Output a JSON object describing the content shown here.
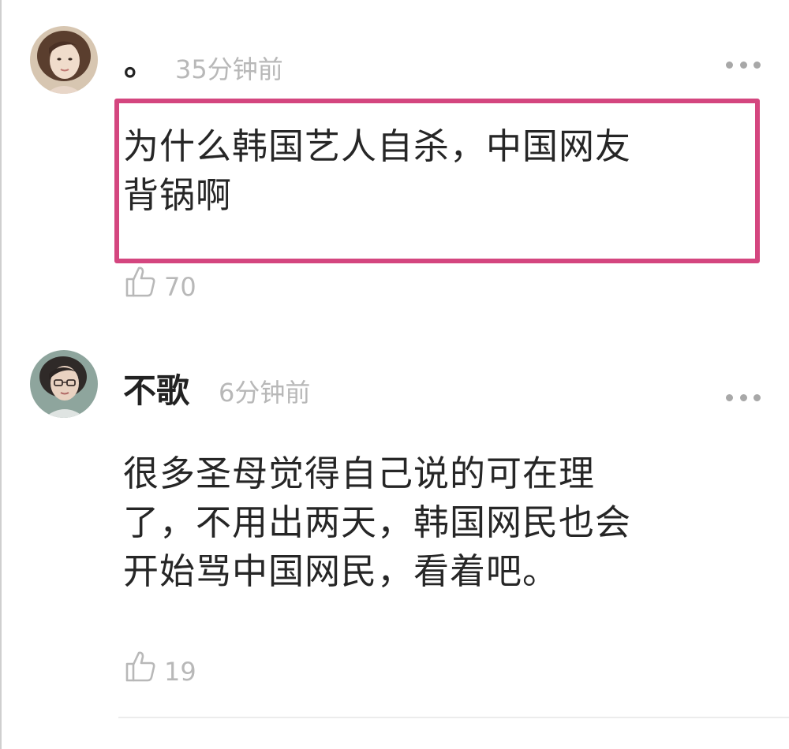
{
  "comments": [
    {
      "username": "。",
      "timestamp": "35分钟前",
      "content_lines": [
        "为什么韩国艺人自杀，中国网友",
        "背锅啊"
      ],
      "likes": "70",
      "highlighted": true,
      "avatar_icon": "user-avatar-icon"
    },
    {
      "username": "不歌",
      "timestamp": "6分钟前",
      "content_lines": [
        "很多圣母觉得自己说的可在理",
        "了，不用出两天，韩国网民也会",
        "开始骂中国网民，看着吧。"
      ],
      "likes": "19",
      "highlighted": false,
      "avatar_icon": "user-avatar-icon"
    }
  ],
  "icons": {
    "like": "thumbs-up-icon",
    "more": "more-options-icon"
  },
  "colors": {
    "highlight_border": "#d4467f",
    "text_primary": "#262626",
    "text_secondary": "#b8b8b8"
  }
}
